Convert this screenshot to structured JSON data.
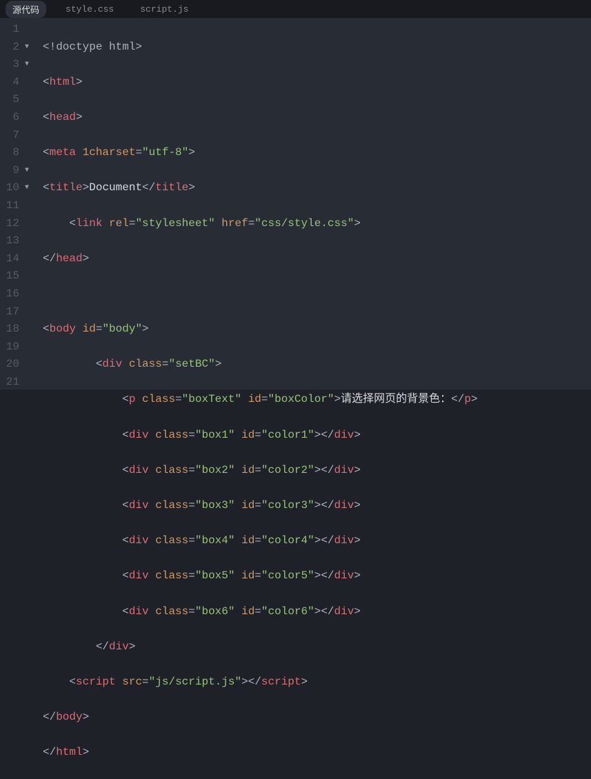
{
  "tabs": {
    "items": [
      {
        "label": "源代码",
        "active": true
      },
      {
        "label": "style.css",
        "active": false
      },
      {
        "label": "script.js",
        "active": false
      }
    ]
  },
  "gutter": {
    "lines": [
      {
        "n": "1",
        "fold": ""
      },
      {
        "n": "2",
        "fold": "▼"
      },
      {
        "n": "3",
        "fold": "▼"
      },
      {
        "n": "4",
        "fold": ""
      },
      {
        "n": "5",
        "fold": ""
      },
      {
        "n": "6",
        "fold": ""
      },
      {
        "n": "7",
        "fold": ""
      },
      {
        "n": "8",
        "fold": ""
      },
      {
        "n": "9",
        "fold": "▼"
      },
      {
        "n": "10",
        "fold": "▼"
      },
      {
        "n": "11",
        "fold": ""
      },
      {
        "n": "12",
        "fold": ""
      },
      {
        "n": "13",
        "fold": ""
      },
      {
        "n": "14",
        "fold": ""
      },
      {
        "n": "15",
        "fold": ""
      },
      {
        "n": "16",
        "fold": ""
      },
      {
        "n": "17",
        "fold": ""
      },
      {
        "n": "18",
        "fold": ""
      },
      {
        "n": "19",
        "fold": ""
      },
      {
        "n": "20",
        "fold": ""
      },
      {
        "n": "21",
        "fold": ""
      }
    ]
  },
  "code": {
    "l1": {
      "open": "<!",
      "name": "doctype html",
      "close": ">"
    },
    "l2": {
      "b1": "<",
      "t": "html",
      "b2": ">"
    },
    "l3": {
      "b1": "<",
      "t": "head",
      "b2": ">"
    },
    "l4": {
      "b1": "<",
      "t": "meta",
      "sp": " ",
      "a": "1charset",
      "eq": "=",
      "s": "\"utf-8\"",
      "b2": ">"
    },
    "l5": {
      "b1": "<",
      "t": "title",
      "b2": ">",
      "txt": "Document",
      "b3": "</",
      "t2": "title",
      "b4": ">"
    },
    "l6": {
      "pad": "    ",
      "b1": "<",
      "t": "link",
      "sp": " ",
      "a1": "rel",
      "eq1": "=",
      "s1": "\"stylesheet\"",
      "sp2": " ",
      "a2": "href",
      "eq2": "=",
      "s2": "\"css/style.css\"",
      "b2": ">"
    },
    "l7": {
      "b1": "</",
      "t": "head",
      "b2": ">"
    },
    "l8": {
      "blank": ""
    },
    "l9": {
      "b1": "<",
      "t": "body",
      "sp": " ",
      "a": "id",
      "eq": "=",
      "s": "\"body\"",
      "b2": ">"
    },
    "l10": {
      "pad": "        ",
      "b1": "<",
      "t": "div",
      "sp": " ",
      "a": "class",
      "eq": "=",
      "s": "\"setBC\"",
      "b2": ">"
    },
    "l11": {
      "pad": "            ",
      "b1": "<",
      "t": "p",
      "sp": " ",
      "a1": "class",
      "eq1": "=",
      "s1": "\"boxText\"",
      "sp2": " ",
      "a2": "id",
      "eq2": "=",
      "s2": "\"boxColor\"",
      "b2": ">",
      "txt": "请选择网页的背景色：",
      "b3": "</",
      "t2": "p",
      "b4": ">"
    },
    "l12": {
      "pad": "            ",
      "b1": "<",
      "t": "div",
      "sp": " ",
      "a1": "class",
      "eq1": "=",
      "s1": "\"box1\"",
      "sp2": " ",
      "a2": "id",
      "eq2": "=",
      "s2": "\"color1\"",
      "b2": "></",
      "t2": "div",
      "b3": ">"
    },
    "l13": {
      "pad": "            ",
      "b1": "<",
      "t": "div",
      "sp": " ",
      "a1": "class",
      "eq1": "=",
      "s1": "\"box2\"",
      "sp2": " ",
      "a2": "id",
      "eq2": "=",
      "s2": "\"color2\"",
      "b2": "></",
      "t2": "div",
      "b3": ">"
    },
    "l14": {
      "pad": "            ",
      "b1": "<",
      "t": "div",
      "sp": " ",
      "a1": "class",
      "eq1": "=",
      "s1": "\"box3\"",
      "sp2": " ",
      "a2": "id",
      "eq2": "=",
      "s2": "\"color3\"",
      "b2": "></",
      "t2": "div",
      "b3": ">"
    },
    "l15": {
      "pad": "            ",
      "b1": "<",
      "t": "div",
      "sp": " ",
      "a1": "class",
      "eq1": "=",
      "s1": "\"box4\"",
      "sp2": " ",
      "a2": "id",
      "eq2": "=",
      "s2": "\"color4\"",
      "b2": "></",
      "t2": "div",
      "b3": ">"
    },
    "l16": {
      "pad": "            ",
      "b1": "<",
      "t": "div",
      "sp": " ",
      "a1": "class",
      "eq1": "=",
      "s1": "\"box5\"",
      "sp2": " ",
      "a2": "id",
      "eq2": "=",
      "s2": "\"color5\"",
      "b2": "></",
      "t2": "div",
      "b3": ">"
    },
    "l17": {
      "pad": "            ",
      "b1": "<",
      "t": "div",
      "sp": " ",
      "a1": "class",
      "eq1": "=",
      "s1": "\"box6\"",
      "sp2": " ",
      "a2": "id",
      "eq2": "=",
      "s2": "\"color6\"",
      "b2": "></",
      "t2": "div",
      "b3": ">"
    },
    "l18": {
      "pad": "        ",
      "b1": "</",
      "t": "div",
      "b2": ">"
    },
    "l19": {
      "pad": "    ",
      "b1": "<",
      "t": "script",
      "sp": " ",
      "a": "src",
      "eq": "=",
      "s": "\"js/script.js\"",
      "b2": "></",
      "t2": "script",
      "b3": ">"
    },
    "l20": {
      "b1": "</",
      "t": "body",
      "b2": ">"
    },
    "l21": {
      "b1": "</",
      "t": "html",
      "b2": ">"
    }
  }
}
